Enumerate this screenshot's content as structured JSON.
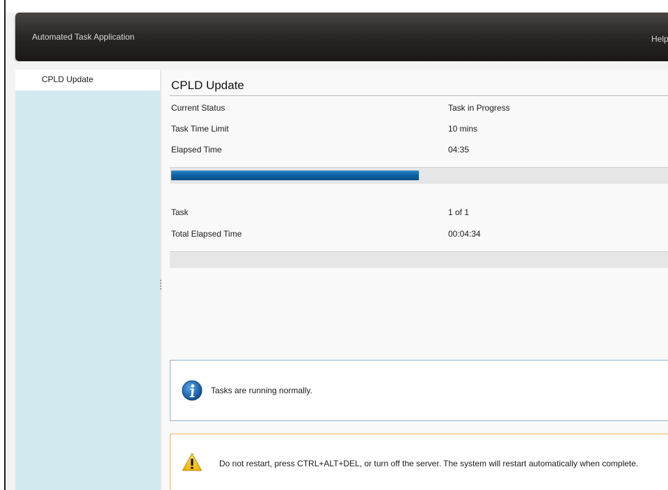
{
  "header": {
    "app_title": "Automated Task Application",
    "help_label": "Help"
  },
  "sidebar": {
    "items": [
      {
        "label": "CPLD Update",
        "selected": true
      }
    ]
  },
  "main": {
    "title": "CPLD Update",
    "task_details": [
      {
        "label": "Current Status",
        "value": "Task in Progress"
      },
      {
        "label": "Task Time Limit",
        "value": "10 mins"
      },
      {
        "label": "Elapsed Time",
        "value": "04:35"
      }
    ],
    "task_progress_fraction": 0.5,
    "overall_details": [
      {
        "label": "Task",
        "value": "1 of 1"
      },
      {
        "label": "Total Elapsed Time",
        "value": "00:04:34"
      }
    ],
    "overall_progress_fraction": 0.0,
    "info_message": "Tasks are running normally.",
    "warning_message": "Do not restart, press CTRL+ALT+DEL, or turn off the server.  The system will restart automatically when complete."
  },
  "colors": {
    "header_bg": "#2b2826",
    "sidebar_bg": "#d2e9ef",
    "progress_fill": "#0c63a8",
    "info_border": "#8fb2cf",
    "warning_border": "#e9b566"
  },
  "icons": {
    "info": "info-icon",
    "warning": "warning-icon"
  }
}
